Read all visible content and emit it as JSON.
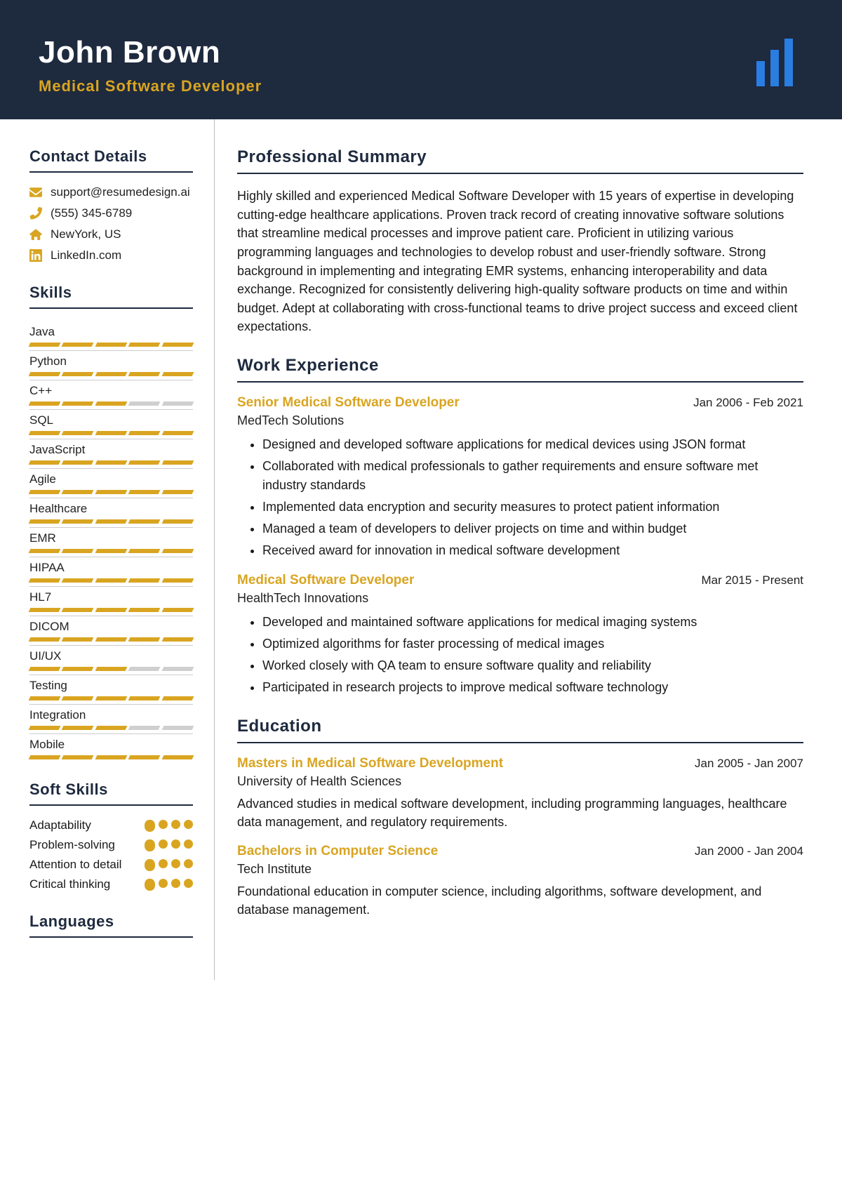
{
  "header": {
    "name": "John Brown",
    "title": "Medical Software Developer"
  },
  "contact": {
    "heading": "Contact Details",
    "items": [
      {
        "icon": "envelope-icon",
        "value": "support@resumedesign.ai"
      },
      {
        "icon": "phone-icon",
        "value": "(555) 345-6789"
      },
      {
        "icon": "home-icon",
        "value": "NewYork, US"
      },
      {
        "icon": "linkedin-icon",
        "value": "LinkedIn.com"
      }
    ]
  },
  "skills": {
    "heading": "Skills",
    "items": [
      {
        "name": "Java",
        "level": 5
      },
      {
        "name": "Python",
        "level": 5
      },
      {
        "name": "C++",
        "level": 3
      },
      {
        "name": "SQL",
        "level": 5
      },
      {
        "name": "JavaScript",
        "level": 5
      },
      {
        "name": "Agile",
        "level": 5
      },
      {
        "name": "Healthcare",
        "level": 5
      },
      {
        "name": "EMR",
        "level": 5
      },
      {
        "name": "HIPAA",
        "level": 5
      },
      {
        "name": "HL7",
        "level": 5
      },
      {
        "name": "DICOM",
        "level": 5
      },
      {
        "name": "UI/UX",
        "level": 3
      },
      {
        "name": "Testing",
        "level": 5
      },
      {
        "name": "Integration",
        "level": 3
      },
      {
        "name": "Mobile",
        "level": 5
      }
    ]
  },
  "soft_skills": {
    "heading": "Soft Skills",
    "items": [
      {
        "name": "Adaptability",
        "level": 4
      },
      {
        "name": "Problem-solving",
        "level": 4
      },
      {
        "name": "Attention to detail",
        "level": 4
      },
      {
        "name": "Critical thinking",
        "level": 4
      }
    ]
  },
  "languages": {
    "heading": "Languages"
  },
  "summary": {
    "heading": "Professional Summary",
    "text": "Highly skilled and experienced Medical Software Developer with 15 years of expertise in developing cutting-edge healthcare applications. Proven track record of creating innovative software solutions that streamline medical processes and improve patient care. Proficient in utilizing various programming languages and technologies to develop robust and user-friendly software. Strong background in implementing and integrating EMR systems, enhancing interoperability and data exchange. Recognized for consistently delivering high-quality software products on time and within budget. Adept at collaborating with cross-functional teams to drive project success and exceed client expectations."
  },
  "work": {
    "heading": "Work Experience",
    "items": [
      {
        "title": "Senior Medical Software Developer",
        "dates": "Jan 2006 - Feb 2021",
        "company": "MedTech Solutions",
        "bullets": [
          "Designed and developed software applications for medical devices using JSON format",
          "Collaborated with medical professionals to gather requirements and ensure software met industry standards",
          "Implemented data encryption and security measures to protect patient information",
          "Managed a team of developers to deliver projects on time and within budget",
          "Received award for innovation in medical software development"
        ]
      },
      {
        "title": "Medical Software Developer",
        "dates": "Mar 2015 - Present",
        "company": "HealthTech Innovations",
        "bullets": [
          "Developed and maintained software applications for medical imaging systems",
          "Optimized algorithms for faster processing of medical images",
          "Worked closely with QA team to ensure software quality and reliability",
          "Participated in research projects to improve medical software technology"
        ]
      }
    ]
  },
  "education": {
    "heading": "Education",
    "items": [
      {
        "title": "Masters in Medical Software Development",
        "dates": "Jan 2005 - Jan 2007",
        "school": "University of Health Sciences",
        "desc": "Advanced studies in medical software development, including programming languages, healthcare data management, and regulatory requirements."
      },
      {
        "title": "Bachelors in Computer Science",
        "dates": "Jan 2000 - Jan 2004",
        "school": "Tech Institute",
        "desc": "Foundational education in computer science, including algorithms, software development, and database management."
      }
    ]
  }
}
